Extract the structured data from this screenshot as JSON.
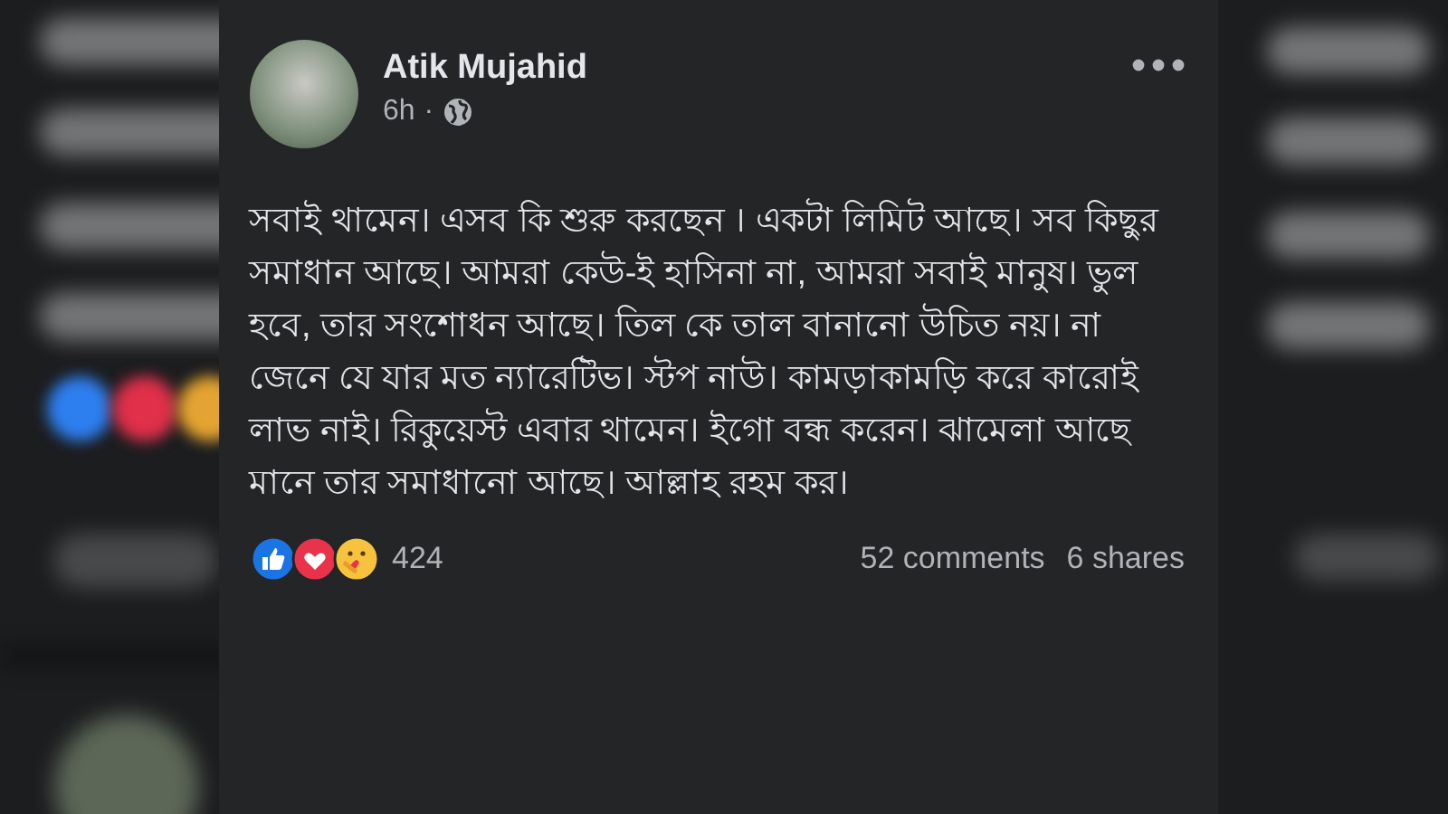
{
  "post": {
    "author": "Atik Mujahid",
    "time": "6h",
    "separator": "·",
    "body": "সবাই থামেন। এসব কি শুরু করছেন । একটা লিমিট আছে। সব কিছুর সমাধান আছে। আমরা কেউ-ই হাসিনা না, আমরা সবাই মানুষ। ভুল হবে, তার সংশোধন আছে। তিল কে তাল বানানো উচিত নয়। না জেনে যে যার মত ন্যারেটিভ। স্টপ নাউ। কামড়াকামড়ি করে কারোই লাভ নাই। রিকুয়েস্ট এবার থামেন। ইগো বন্ধ করেন। ঝামেলা আছে মানে তার সমাধানো আছে। আল্লাহ রহম কর।",
    "reaction_count": "424",
    "comments": "52 comments",
    "shares": "6 shares"
  }
}
